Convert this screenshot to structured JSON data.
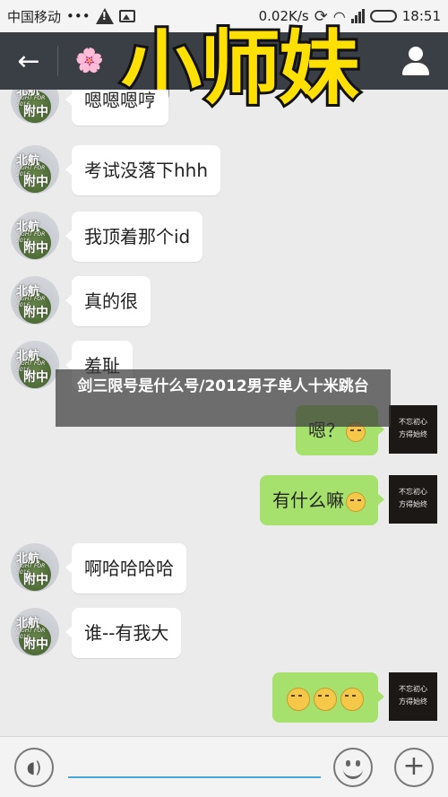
{
  "status_bar": {
    "carrier": "中国移动",
    "dots": "•••",
    "speed": "0.02K/s",
    "time": "18:51"
  },
  "title_bar": {
    "back_icon": "back-arrow-icon",
    "contact_name": "小师妹",
    "profile_icon": "person-icon"
  },
  "messages": [
    {
      "side": "left",
      "text": "嗯嗯嗯哼"
    },
    {
      "side": "left",
      "text": "考试没落下hhh"
    },
    {
      "side": "left",
      "text": "我顶着那个id"
    },
    {
      "side": "left",
      "text": "真的很"
    },
    {
      "side": "left",
      "text": "羞耻"
    },
    {
      "side": "right",
      "text": "嗯？"
    },
    {
      "side": "right",
      "text": "有什么嘛"
    },
    {
      "side": "left",
      "text": "啊哈哈哈哈"
    },
    {
      "side": "left",
      "text": "谁--有我大"
    },
    {
      "side": "right",
      "text": ""
    }
  ],
  "left_avatar": {
    "line1": "北航",
    "line2": "FIGHT FOR 2016",
    "line3": "附中"
  },
  "right_avatar": {
    "line1": "不忘初心",
    "line2": "方得始终"
  },
  "watermark": "剑三限号是什么号/2012男子单人十米跳台",
  "input_bar": {
    "voice_icon": "voice-icon",
    "emoji_icon": "emoji-icon",
    "plus_icon": "plus-icon"
  },
  "colors": {
    "title_bar_bg": "#3a3f45",
    "title_overlay": "#ffe000",
    "sent_bubble": "#a5e16c",
    "chat_bg": "#ebebeb"
  }
}
